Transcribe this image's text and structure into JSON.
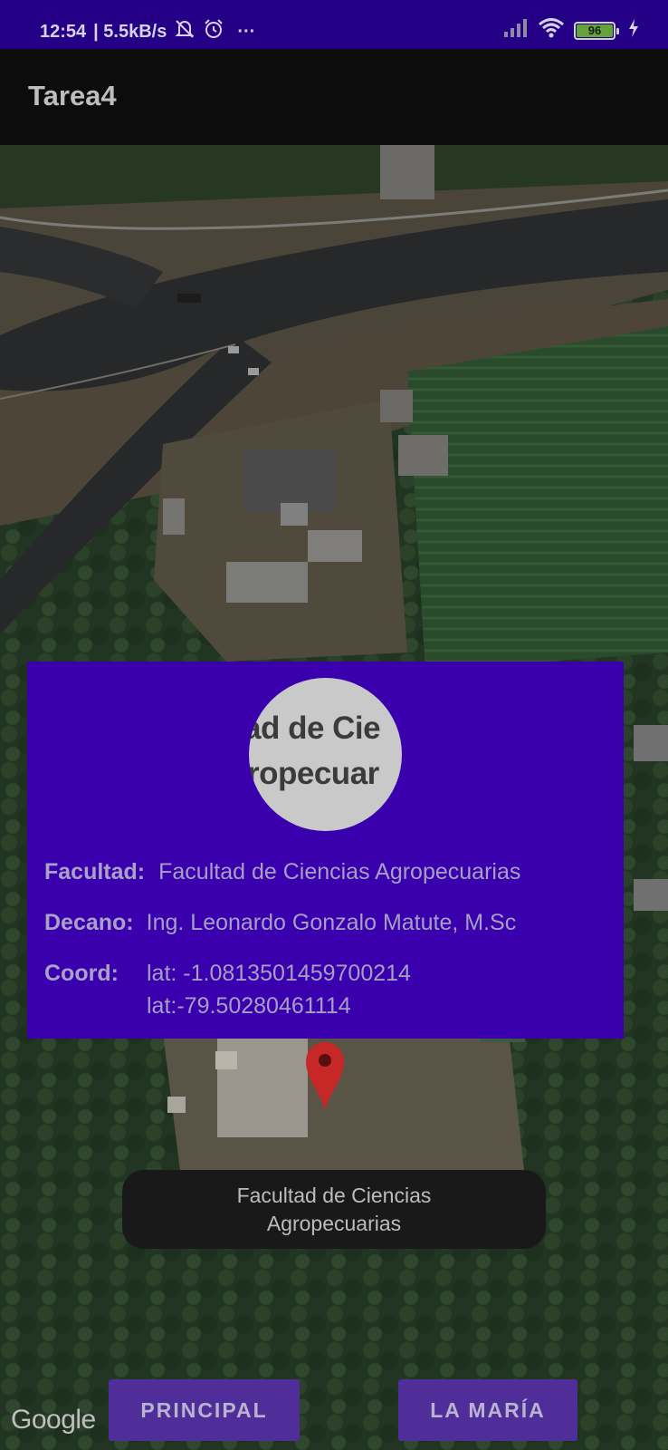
{
  "status_bar": {
    "time": "12:54",
    "net_speed": "| 5.5kB/s",
    "more": "···",
    "battery": "96",
    "icons": [
      "bell-muted-icon",
      "alarm-icon",
      "signal-icon",
      "wifi-icon",
      "battery-icon",
      "charging-icon"
    ]
  },
  "app_bar": {
    "title": "Tarea4"
  },
  "info_window": {
    "logo_text_line1": "ad de Cie",
    "logo_text_line2": "ropecuar",
    "facultad_label": "Facultad:",
    "facultad_value": "Facultad de Ciencias Agropecuarias",
    "decano_label": "Decano:",
    "decano_value": "Ing. Leonardo Gonzalo Matute, M.Sc",
    "coord_label": "Coord:",
    "coord_lat": "lat: -1.0813501459700214",
    "coord_lng": "lat:-79.50280461114"
  },
  "toast": {
    "text": "Facultad de Ciencias Agropecuarias"
  },
  "buttons": {
    "principal": "PRINCIPAL",
    "la_maria": "LA MARÍA"
  },
  "map": {
    "attribution": "Google",
    "marker_color": "#c62828",
    "type": "satellite"
  },
  "colors": {
    "status_bar": "#240086",
    "info_window": "#3a00ad",
    "button": "#4f2e99",
    "app_bar": "#0c0c0c"
  }
}
